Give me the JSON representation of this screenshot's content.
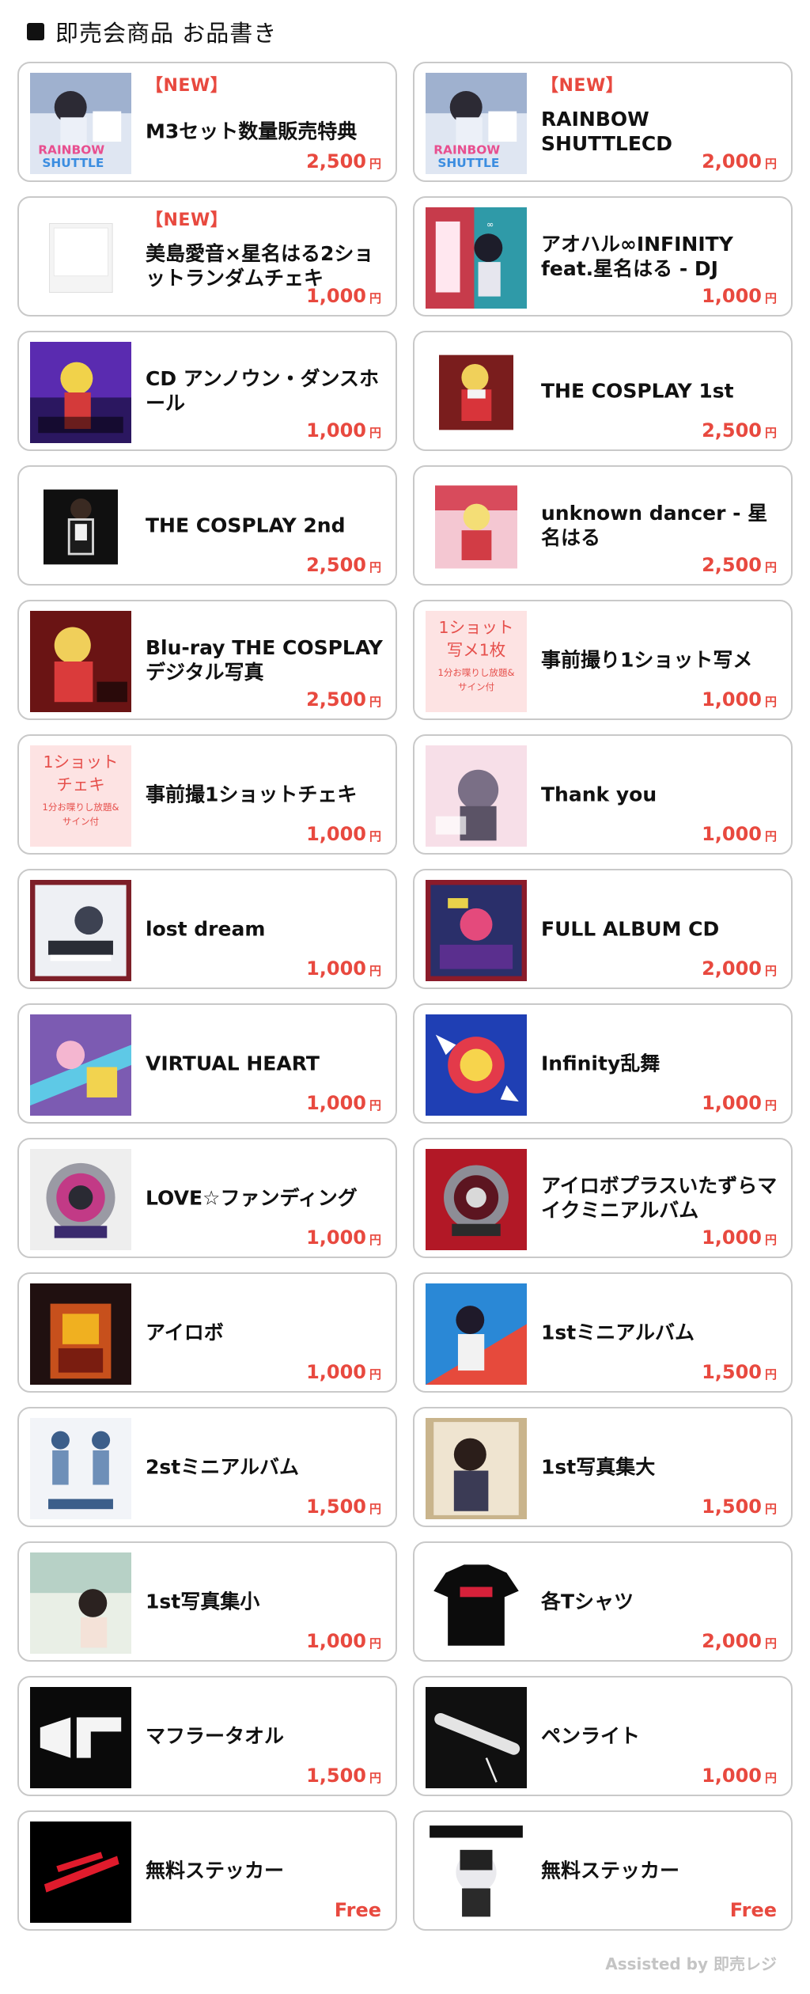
{
  "header": {
    "title": "即売会商品 お品書き"
  },
  "currency_unit": "円",
  "colors": {
    "accent": "#e8493f",
    "border": "#c9c9c9",
    "footer": "#c4c4c4"
  },
  "products": [
    {
      "badge": "【NEW】",
      "title": "M3セット数量販売特典",
      "price": "2,500",
      "art": "rainbow-cd-art"
    },
    {
      "badge": "【NEW】",
      "title": "RAINBOW SHUTTLECD",
      "price": "2,000",
      "art": "rainbow-cd-art"
    },
    {
      "badge": "【NEW】",
      "title": "美島愛音×星名はる2ショットランダムチェキ",
      "price": "1,000",
      "art": "blank-cheki-art"
    },
    {
      "title": "アオハル∞INFINITY feat.星名はる - DJ",
      "price": "1,000",
      "art": "aoharu-art"
    },
    {
      "title": "CD アンノウン・ダンスホール",
      "price": "1,000",
      "art": "unknown-dancehall-art"
    },
    {
      "title": "THE COSPLAY 1st",
      "price": "2,500",
      "art": "cosplay-1st-art"
    },
    {
      "title": "THE COSPLAY 2nd",
      "price": "2,500",
      "art": "cosplay-2nd-art"
    },
    {
      "title": "unknown dancer - 星名はる",
      "price": "2,500",
      "art": "unknown-dancer-art"
    },
    {
      "title": "Blu-ray THE COSPLAY デジタル写真",
      "price": "2,500",
      "art": "bluray-art"
    },
    {
      "title": "事前撮り1ショット写メ",
      "price": "1,000",
      "art": "shame-card-art",
      "card_text": [
        "1ショット",
        "写メ1枚",
        "1分お喋りし放題&",
        "サイン付"
      ]
    },
    {
      "title": "事前撮1ショットチェキ",
      "price": "1,000",
      "art": "cheki-card-art",
      "card_text": [
        "1ショット",
        "チェキ",
        "1分お喋りし放題&",
        "サイン付"
      ]
    },
    {
      "title": "Thank you",
      "price": "1,000",
      "art": "thankyou-art"
    },
    {
      "title": "lost dream",
      "price": "1,000",
      "art": "lost-dream-art"
    },
    {
      "title": "FULL ALBUM CD",
      "price": "2,000",
      "art": "full-album-art"
    },
    {
      "title": "VIRTUAL HEART",
      "price": "1,000",
      "art": "virtual-heart-art"
    },
    {
      "title": "Infinity乱舞",
      "price": "1,000",
      "art": "infinity-ranbu-art"
    },
    {
      "title": "LOVE☆ファンディング",
      "price": "1,000",
      "art": "love-funding-art"
    },
    {
      "title": "アイロボプラスいたずらマイクミニアルバム",
      "price": "1,000",
      "art": "airobo-plus-art"
    },
    {
      "title": "アイロボ",
      "price": "1,000",
      "art": "airobo-art"
    },
    {
      "title": "1stミニアルバム",
      "price": "1,500",
      "art": "mini-album-1st-art"
    },
    {
      "title": "2stミニアルバム",
      "price": "1,500",
      "art": "mini-album-2st-art"
    },
    {
      "title": "1st写真集大",
      "price": "1,500",
      "art": "photobook-large-art"
    },
    {
      "title": "1st写真集小",
      "price": "1,000",
      "art": "photobook-small-art"
    },
    {
      "title": "各Tシャツ",
      "price": "2,000",
      "art": "tshirt-art"
    },
    {
      "title": "マフラータオル",
      "price": "1,500",
      "art": "towel-art"
    },
    {
      "title": "ペンライト",
      "price": "1,000",
      "art": "penlight-art"
    },
    {
      "title": "無料ステッカー",
      "price": "Free",
      "art": "sticker-red-art"
    },
    {
      "title": "無料ステッカー",
      "price": "Free",
      "art": "sticker-hapicore-art"
    }
  ],
  "footer": {
    "text": "Assisted by 即売レジ"
  }
}
